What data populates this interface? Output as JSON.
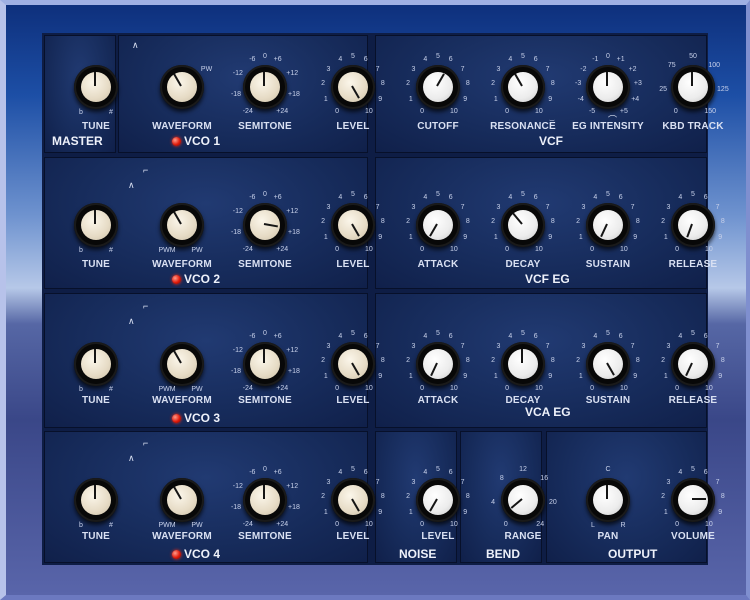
{
  "sections": {
    "master": {
      "title": "MASTER"
    },
    "vco1": {
      "title": "VCO 1"
    },
    "vco2": {
      "title": "VCO 2"
    },
    "vco3": {
      "title": "VCO 3"
    },
    "vco4": {
      "title": "VCO 4"
    },
    "vcf": {
      "title": "VCF"
    },
    "vcf_eg": {
      "title": "VCF EG"
    },
    "vca_eg": {
      "title": "VCA EG"
    },
    "noise": {
      "title": "NOISE"
    },
    "bend": {
      "title": "BEND"
    },
    "output": {
      "title": "OUTPUT"
    }
  },
  "knobs": [
    {
      "id": "master-tune",
      "label": "TUNE",
      "angle": 0,
      "style": "cream",
      "ticks": [
        "b",
        "#"
      ]
    },
    {
      "id": "vco1-waveform",
      "label": "WAVEFORM",
      "angle": -30,
      "style": "cream",
      "ticks": [
        "PW"
      ]
    },
    {
      "id": "vco1-semitone",
      "label": "SEMITONE",
      "angle": 0,
      "style": "cream",
      "ticks": [
        "-6",
        "0",
        "+6",
        "-12",
        "+12",
        "-18",
        "+18",
        "-24",
        "+24"
      ]
    },
    {
      "id": "vco1-level",
      "label": "LEVEL",
      "angle": 150,
      "style": "cream",
      "ticks": [
        "4",
        "5",
        "6",
        "3",
        "7",
        "2",
        "8",
        "1",
        "9",
        "0",
        "10"
      ]
    },
    {
      "id": "vcf-cutoff",
      "label": "CUTOFF",
      "angle": 30,
      "style": "white",
      "ticks": [
        "4",
        "5",
        "6",
        "3",
        "7",
        "2",
        "8",
        "1",
        "9",
        "0",
        "10"
      ]
    },
    {
      "id": "vcf-resonance",
      "label": "RESONANCE",
      "angle": -30,
      "style": "white",
      "ticks": [
        "4",
        "5",
        "6",
        "3",
        "7",
        "2",
        "8",
        "1",
        "9",
        "0",
        "10"
      ]
    },
    {
      "id": "vcf-eg-intensity",
      "label": "EG INTENSITY",
      "angle": 0,
      "style": "white",
      "ticks": [
        "-1",
        "0",
        "+1",
        "-2",
        "+2",
        "-3",
        "+3",
        "-4",
        "+4",
        "-5",
        "+5"
      ]
    },
    {
      "id": "vcf-kbd-track",
      "label": "KBD TRACK",
      "angle": 0,
      "style": "white",
      "ticks": [
        "50",
        "75",
        "100",
        "25",
        "125",
        "0",
        "150"
      ]
    },
    {
      "id": "vco2-tune",
      "label": "TUNE",
      "angle": 0,
      "style": "cream",
      "ticks": [
        "b",
        "#"
      ]
    },
    {
      "id": "vco2-waveform",
      "label": "WAVEFORM",
      "angle": -30,
      "style": "cream",
      "ticks": [
        "PWM",
        "PW"
      ]
    },
    {
      "id": "vco2-semitone",
      "label": "SEMITONE",
      "angle": 100,
      "style": "cream",
      "ticks": [
        "-6",
        "0",
        "+6",
        "-12",
        "+12",
        "-18",
        "+18",
        "-24",
        "+24"
      ]
    },
    {
      "id": "vco2-level",
      "label": "LEVEL",
      "angle": 150,
      "style": "cream",
      "ticks": [
        "4",
        "5",
        "6",
        "3",
        "7",
        "2",
        "8",
        "1",
        "9",
        "0",
        "10"
      ]
    },
    {
      "id": "vcf-eg-attack",
      "label": "ATTACK",
      "angle": -150,
      "style": "white",
      "ticks": [
        "4",
        "5",
        "6",
        "3",
        "7",
        "2",
        "8",
        "1",
        "9",
        "0",
        "10"
      ]
    },
    {
      "id": "vcf-eg-decay",
      "label": "DECAY",
      "angle": -40,
      "style": "white",
      "ticks": [
        "4",
        "5",
        "6",
        "3",
        "7",
        "2",
        "8",
        "1",
        "9",
        "0",
        "10"
      ]
    },
    {
      "id": "vcf-eg-sustain",
      "label": "SUSTAIN",
      "angle": -155,
      "style": "white",
      "ticks": [
        "4",
        "5",
        "6",
        "3",
        "7",
        "2",
        "8",
        "1",
        "9",
        "0",
        "10"
      ]
    },
    {
      "id": "vcf-eg-release",
      "label": "RELEASE",
      "angle": -160,
      "style": "white",
      "ticks": [
        "4",
        "5",
        "6",
        "3",
        "7",
        "2",
        "8",
        "1",
        "9",
        "0",
        "10"
      ]
    },
    {
      "id": "vco3-tune",
      "label": "TUNE",
      "angle": 0,
      "style": "cream",
      "ticks": [
        "b",
        "#"
      ]
    },
    {
      "id": "vco3-waveform",
      "label": "WAVEFORM",
      "angle": -30,
      "style": "cream",
      "ticks": [
        "PWM",
        "PW"
      ]
    },
    {
      "id": "vco3-semitone",
      "label": "SEMITONE",
      "angle": 0,
      "style": "cream",
      "ticks": [
        "-6",
        "0",
        "+6",
        "-12",
        "+12",
        "-18",
        "+18",
        "-24",
        "+24"
      ]
    },
    {
      "id": "vco3-level",
      "label": "LEVEL",
      "angle": 150,
      "style": "cream",
      "ticks": [
        "4",
        "5",
        "6",
        "3",
        "7",
        "2",
        "8",
        "1",
        "9",
        "0",
        "10"
      ]
    },
    {
      "id": "vca-eg-attack",
      "label": "ATTACK",
      "angle": -155,
      "style": "white",
      "ticks": [
        "4",
        "5",
        "6",
        "3",
        "7",
        "2",
        "8",
        "1",
        "9",
        "0",
        "10"
      ]
    },
    {
      "id": "vca-eg-decay",
      "label": "DECAY",
      "angle": 0,
      "style": "white",
      "ticks": [
        "4",
        "5",
        "6",
        "3",
        "7",
        "2",
        "8",
        "1",
        "9",
        "0",
        "10"
      ]
    },
    {
      "id": "vca-eg-sustain",
      "label": "SUSTAIN",
      "angle": 150,
      "style": "white",
      "ticks": [
        "4",
        "5",
        "6",
        "3",
        "7",
        "2",
        "8",
        "1",
        "9",
        "0",
        "10"
      ]
    },
    {
      "id": "vca-eg-release",
      "label": "RELEASE",
      "angle": -155,
      "style": "white",
      "ticks": [
        "4",
        "5",
        "6",
        "3",
        "7",
        "2",
        "8",
        "1",
        "9",
        "0",
        "10"
      ]
    },
    {
      "id": "vco4-tune",
      "label": "TUNE",
      "angle": 0,
      "style": "cream",
      "ticks": [
        "b",
        "#"
      ]
    },
    {
      "id": "vco4-waveform",
      "label": "WAVEFORM",
      "angle": -30,
      "style": "cream",
      "ticks": [
        "PWM",
        "PW"
      ]
    },
    {
      "id": "vco4-semitone",
      "label": "SEMITONE",
      "angle": 0,
      "style": "cream",
      "ticks": [
        "-6",
        "0",
        "+6",
        "-12",
        "+12",
        "-18",
        "+18",
        "-24",
        "+24"
      ]
    },
    {
      "id": "vco4-level",
      "label": "LEVEL",
      "angle": 150,
      "style": "cream",
      "ticks": [
        "4",
        "5",
        "6",
        "3",
        "7",
        "2",
        "8",
        "1",
        "9",
        "0",
        "10"
      ]
    },
    {
      "id": "noise-level",
      "label": "LEVEL",
      "angle": -150,
      "style": "white",
      "ticks": [
        "4",
        "5",
        "6",
        "3",
        "7",
        "2",
        "8",
        "1",
        "9",
        "0",
        "10"
      ]
    },
    {
      "id": "bend-range",
      "label": "RANGE",
      "angle": -130,
      "style": "white",
      "ticks": [
        "12",
        "8",
        "16",
        "4",
        "20",
        "0",
        "24"
      ]
    },
    {
      "id": "output-pan",
      "label": "PAN",
      "angle": 0,
      "style": "white",
      "ticks": [
        "C",
        "L",
        "R"
      ]
    },
    {
      "id": "output-volume",
      "label": "VOLUME",
      "angle": 90,
      "style": "white",
      "ticks": [
        "4",
        "5",
        "6",
        "3",
        "7",
        "2",
        "8",
        "1",
        "9",
        "0",
        "10"
      ]
    }
  ],
  "colors": {
    "led": "#e01a0a",
    "panel": "#172c5c",
    "knob_cream": "#e6dbc5",
    "knob_white": "#ececec"
  }
}
